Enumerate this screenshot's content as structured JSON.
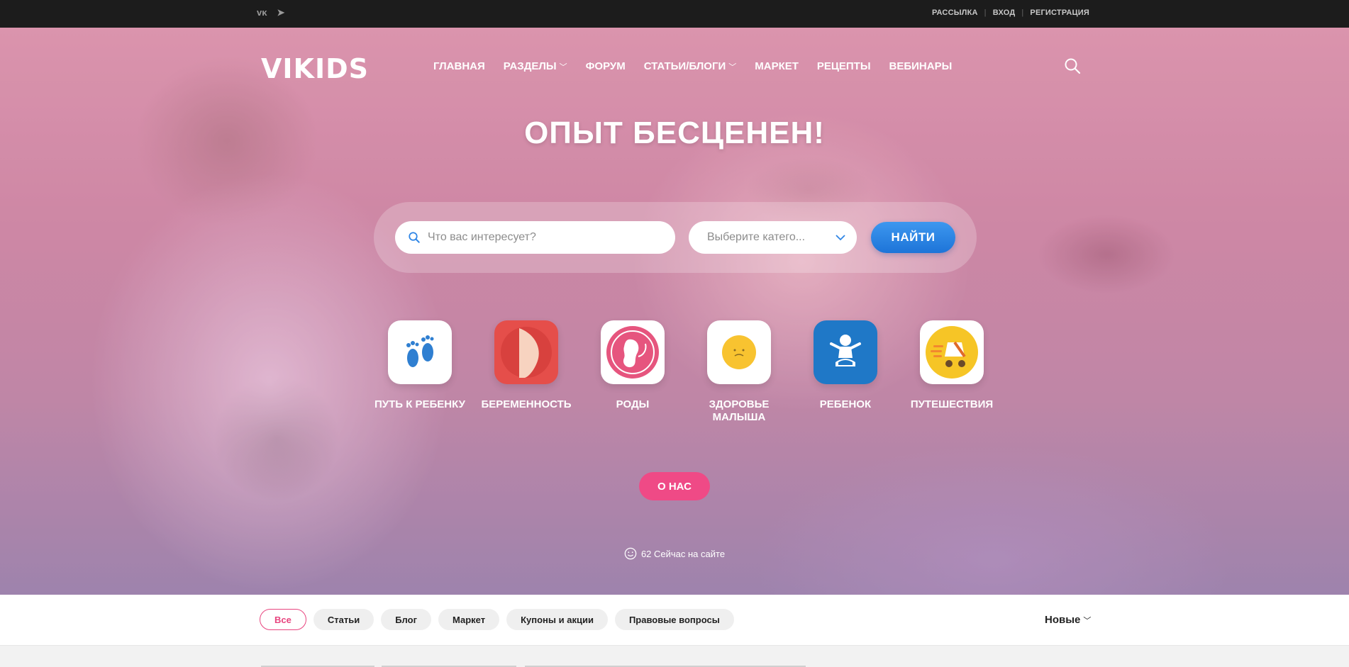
{
  "topbar": {
    "social": [
      {
        "name": "vk-icon",
        "glyph": "ᴠᴋ"
      },
      {
        "name": "telegram-icon",
        "glyph": "➤"
      }
    ],
    "links": [
      "РАССЫЛКА",
      "ВХОД",
      "РЕГИСТРАЦИЯ"
    ]
  },
  "header": {
    "logo": "VIKIDS",
    "nav": [
      {
        "label": "ГЛАВНАЯ",
        "dropdown": false
      },
      {
        "label": "РАЗДЕЛЫ",
        "dropdown": true
      },
      {
        "label": "ФОРУМ",
        "dropdown": false
      },
      {
        "label": "СТАТЬИ/БЛОГИ",
        "dropdown": true
      },
      {
        "label": "МАРКЕТ",
        "dropdown": false
      },
      {
        "label": "РЕЦЕПТЫ",
        "dropdown": false
      },
      {
        "label": "ВЕБИНАРЫ",
        "dropdown": false
      }
    ],
    "search_icon": "search-icon"
  },
  "hero": {
    "headline": "ОПЫТ БЕСЦЕНЕН!",
    "search": {
      "placeholder": "Что вас интересует?",
      "category_placeholder": "Выберите катего...",
      "submit_label": "НАЙТИ"
    },
    "categories": [
      {
        "label": "ПУТЬ К РЕБЕНКУ",
        "icon": "footprints-icon",
        "bg": "#ffffff"
      },
      {
        "label": "БЕРЕМЕННОСТЬ",
        "icon": "pregnancy-icon",
        "bg": "#e54e4a"
      },
      {
        "label": "РОДЫ",
        "icon": "embryo-icon",
        "bg": "#ffffff"
      },
      {
        "label": "ЗДОРОВЬЕ МАЛЫША",
        "icon": "smiley-icon",
        "bg": "#ffffff"
      },
      {
        "label": "РЕБЕНОК",
        "icon": "baby-icon",
        "bg": "#1f78c7"
      },
      {
        "label": "ПУТЕШЕСТВИЯ",
        "icon": "stroller-icon",
        "bg": "#ffffff"
      }
    ],
    "about_label": "О НАС",
    "online_text": "62 Сейчас на сайте"
  },
  "filters": {
    "chips": [
      {
        "label": "Все",
        "active": true
      },
      {
        "label": "Статьи",
        "active": false
      },
      {
        "label": "Блог",
        "active": false
      },
      {
        "label": "Маркет",
        "active": false
      },
      {
        "label": "Купоны и акции",
        "active": false
      },
      {
        "label": "Правовые вопросы",
        "active": false
      }
    ],
    "sort_label": "Новые"
  },
  "colors": {
    "accent_pink": "#ef4a86",
    "accent_blue": "#1d74d8",
    "topbar_bg": "#1c1c1c"
  }
}
